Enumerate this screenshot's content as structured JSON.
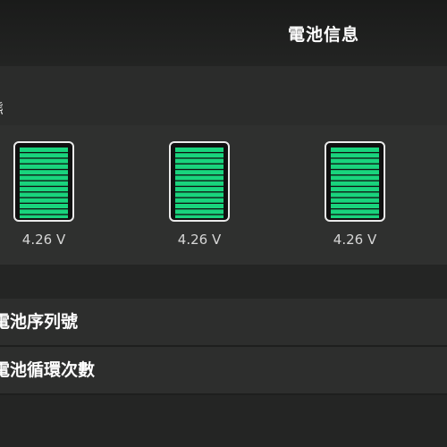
{
  "header": {
    "title": "電池信息"
  },
  "status_section": {
    "label": "態"
  },
  "cells": [
    {
      "voltage": "4.26 V",
      "charge_fraction": 1.0
    },
    {
      "voltage": "4.26 V",
      "charge_fraction": 1.0
    },
    {
      "voltage": "4.26 V",
      "charge_fraction": 1.0
    }
  ],
  "rows": [
    {
      "label": "電池序列號"
    },
    {
      "label": "電池循環次數"
    }
  ],
  "colors": {
    "background": "#242524",
    "panel": "#2f302f",
    "battery_fill": "#19d47d",
    "battery_border": "#eaeaea"
  }
}
